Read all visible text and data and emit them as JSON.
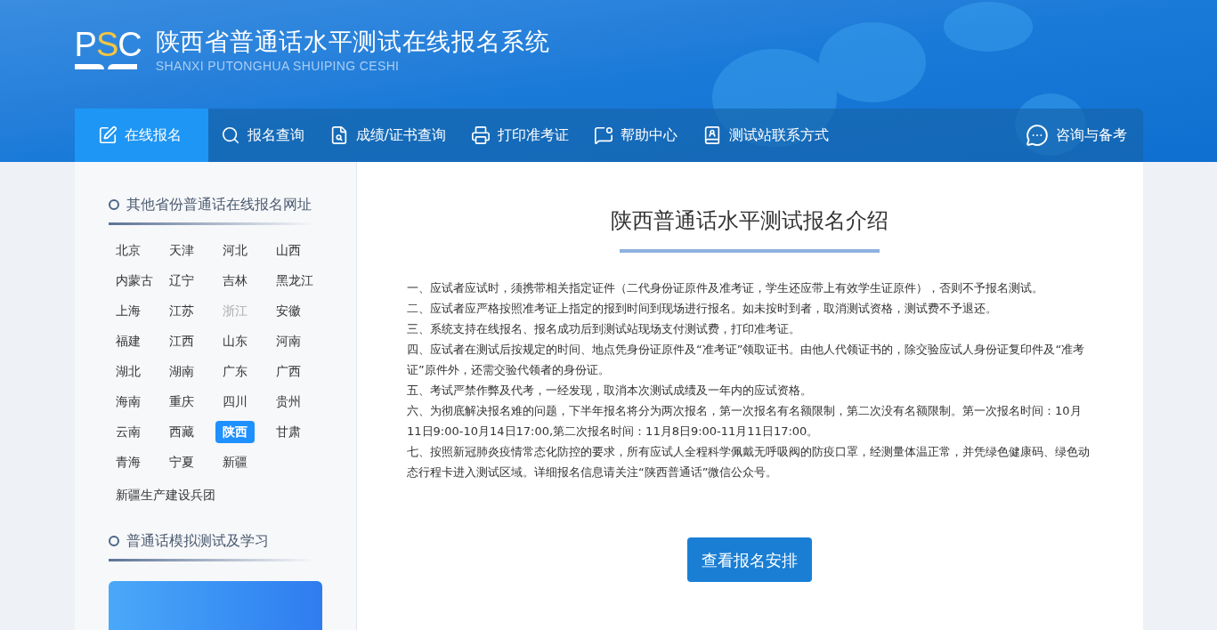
{
  "header": {
    "logo": {
      "left": "P",
      "accent": "S",
      "right": "C"
    },
    "title": "陕西省普通话水平测试在线报名系统",
    "subtitle": "SHANXI PUTONGHUA SHUIPING CESHI"
  },
  "nav": {
    "items": [
      {
        "label": "在线报名",
        "selected": true
      },
      {
        "label": "报名查询",
        "selected": false
      },
      {
        "label": "成绩/证书查询",
        "selected": false
      },
      {
        "label": "打印准考证",
        "selected": false
      },
      {
        "label": "帮助中心",
        "selected": false
      },
      {
        "label": "测试站联系方式",
        "selected": false
      }
    ],
    "consult": {
      "label": "咨询与备考"
    }
  },
  "sidebar": {
    "provinces_title": "其他省份普通话在线报名网址",
    "provinces": [
      {
        "label": "北京",
        "selected": false,
        "disabled": false
      },
      {
        "label": "天津",
        "selected": false,
        "disabled": false
      },
      {
        "label": "河北",
        "selected": false,
        "disabled": false
      },
      {
        "label": "山西",
        "selected": false,
        "disabled": false
      },
      {
        "label": "内蒙古",
        "selected": false,
        "disabled": false
      },
      {
        "label": "辽宁",
        "selected": false,
        "disabled": false
      },
      {
        "label": "吉林",
        "selected": false,
        "disabled": false
      },
      {
        "label": "黑龙江",
        "selected": false,
        "disabled": false
      },
      {
        "label": "上海",
        "selected": false,
        "disabled": false
      },
      {
        "label": "江苏",
        "selected": false,
        "disabled": false
      },
      {
        "label": "浙江",
        "selected": false,
        "disabled": true
      },
      {
        "label": "安徽",
        "selected": false,
        "disabled": false
      },
      {
        "label": "福建",
        "selected": false,
        "disabled": false
      },
      {
        "label": "江西",
        "selected": false,
        "disabled": false
      },
      {
        "label": "山东",
        "selected": false,
        "disabled": false
      },
      {
        "label": "河南",
        "selected": false,
        "disabled": false
      },
      {
        "label": "湖北",
        "selected": false,
        "disabled": false
      },
      {
        "label": "湖南",
        "selected": false,
        "disabled": false
      },
      {
        "label": "广东",
        "selected": false,
        "disabled": false
      },
      {
        "label": "广西",
        "selected": false,
        "disabled": false
      },
      {
        "label": "海南",
        "selected": false,
        "disabled": false
      },
      {
        "label": "重庆",
        "selected": false,
        "disabled": false
      },
      {
        "label": "四川",
        "selected": false,
        "disabled": false
      },
      {
        "label": "贵州",
        "selected": false,
        "disabled": false
      },
      {
        "label": "云南",
        "selected": false,
        "disabled": false
      },
      {
        "label": "西藏",
        "selected": false,
        "disabled": false
      },
      {
        "label": "陕西",
        "selected": true,
        "disabled": false
      },
      {
        "label": "甘肃",
        "selected": false,
        "disabled": false
      },
      {
        "label": "青海",
        "selected": false,
        "disabled": false
      },
      {
        "label": "宁夏",
        "selected": false,
        "disabled": false
      },
      {
        "label": "新疆",
        "selected": false,
        "disabled": false
      }
    ],
    "extra_province": {
      "label": "新疆生产建设兵团",
      "selected": false,
      "disabled": false
    },
    "study_title": "普通话模拟测试及学习"
  },
  "main": {
    "title": "陕西普通话水平测试报名介绍",
    "paragraphs": [
      "一、应试者应试时，须携带相关指定证件（二代身份证原件及准考证，学生还应带上有效学生证原件），否则不予报名测试。",
      "二、应试者应严格按照准考证上指定的报到时间到现场进行报名。如未按时到者，取消测试资格，测试费不予退还。",
      "三、系统支持在线报名、报名成功后到测试站现场支付测试费，打印准考证。",
      "四、应试者在测试后按规定的时间、地点凭身份证原件及“准考证”领取证书。由他人代领证书的，除交验应试人身份证复印件及“准考证”原件外，还需交验代领者的身份证。",
      "五、考试严禁作弊及代考，一经发现，取消本次测试成绩及一年内的应试资格。",
      "六、为彻底解决报名难的问题，下半年报名将分为两次报名，第一次报名有名额限制，第二次没有名额限制。第一次报名时间：10月11日9:00-10月14日17:00,第二次报名时间：11月8日9:00-11月11日17:00。",
      "七、按照新冠肺炎疫情常态化防控的要求，所有应试人全程科学佩戴无呼吸阀的防疫口罩，经测量体温正常，并凭绿色健康码、绿色动态行程卡进入测试区域。详细报名信息请关注“陕西普通话”微信公众号。"
    ],
    "button": "查看报名安排"
  }
}
